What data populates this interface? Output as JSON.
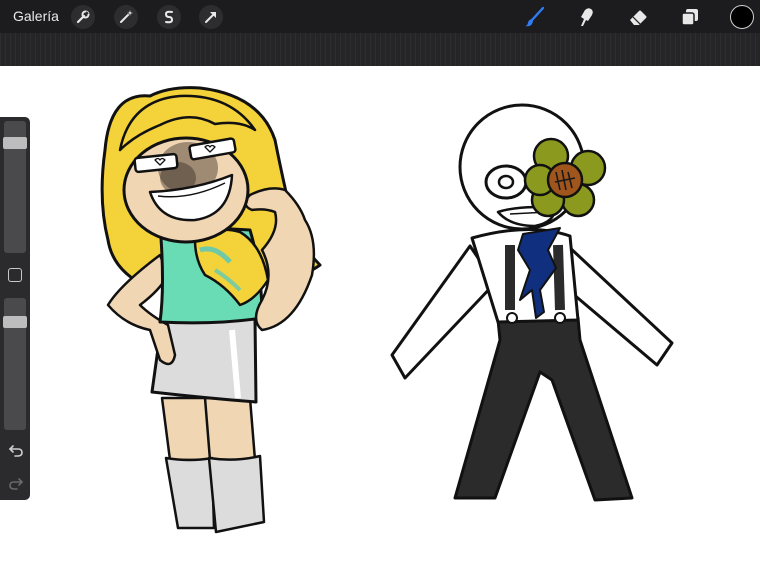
{
  "toolbar": {
    "gallery_label": "Galería",
    "active_tool": "brush",
    "accent_color": "#2f7cf6",
    "current_color": "#000000",
    "icons": [
      "wrench-icon",
      "magic-wand-icon",
      "selection-s-icon",
      "transform-arrow-icon",
      "brush-icon",
      "smudge-icon",
      "eraser-icon",
      "layers-icon"
    ]
  },
  "sidebar": {
    "brush_size_level": 0.87,
    "opacity_level": 0.85,
    "icons": [
      "modify-square-icon",
      "undo-icon",
      "redo-icon"
    ]
  },
  "canvas": {
    "background": "#ffffff",
    "colors": {
      "hair": "#f3d23a",
      "skin": "#f1d6b4",
      "top": "#69dcb5",
      "skirt": "#dcdcdc",
      "pants": "#2b2b2b",
      "tie": "#102f7e",
      "flower_petal": "#8b9a1e",
      "flower_center": "#a0551d"
    }
  }
}
